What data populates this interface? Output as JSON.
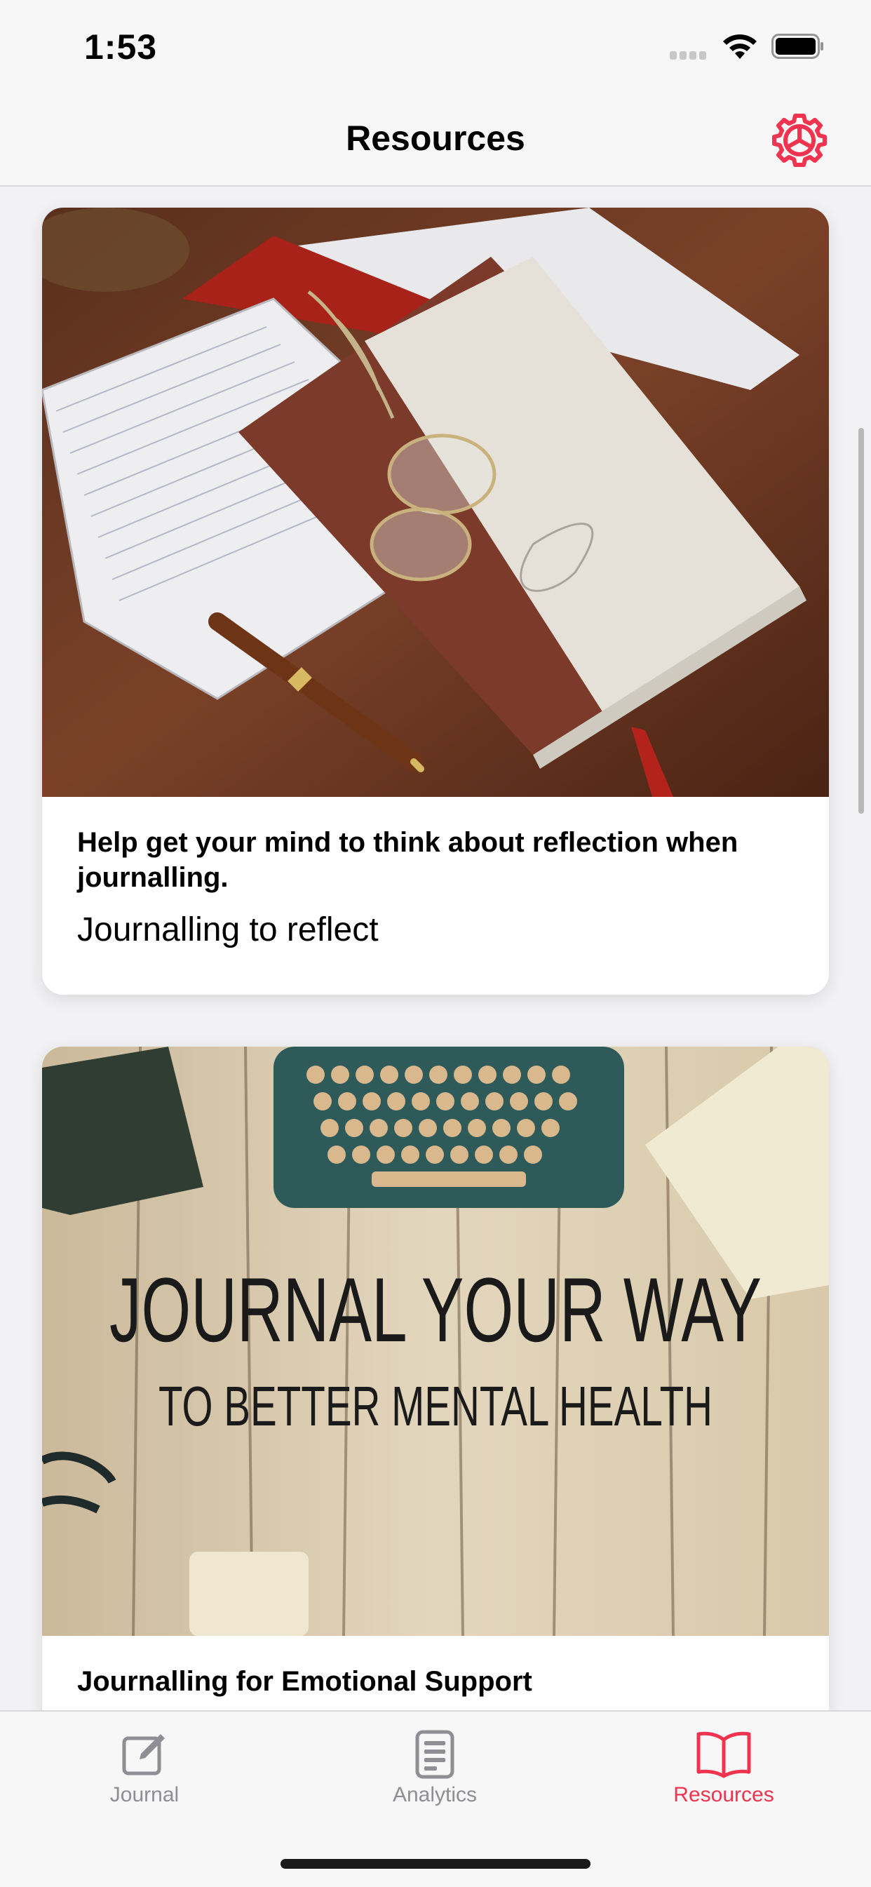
{
  "status_bar": {
    "time": "1:53"
  },
  "nav": {
    "title": "Resources",
    "settings_icon": "gear-icon"
  },
  "cards": [
    {
      "image": "journal-notebook-pen-glasses",
      "title": "Help get your mind to think about reflection when journalling.",
      "subtitle": "Journalling to reflect"
    },
    {
      "image": "typewriter-wood-background",
      "image_text_line1": "JOURNAL YOUR WAY",
      "image_text_line2": "TO BETTER MENTAL HEALTH",
      "title": "Journalling for Emotional Support"
    }
  ],
  "tabs": [
    {
      "label": "Journal",
      "icon": "compose-icon",
      "active": false
    },
    {
      "label": "Analytics",
      "icon": "document-icon",
      "active": false
    },
    {
      "label": "Resources",
      "icon": "book-icon",
      "active": true
    }
  ],
  "colors": {
    "accent": "#f0344f",
    "inactive": "#8e8e93"
  }
}
